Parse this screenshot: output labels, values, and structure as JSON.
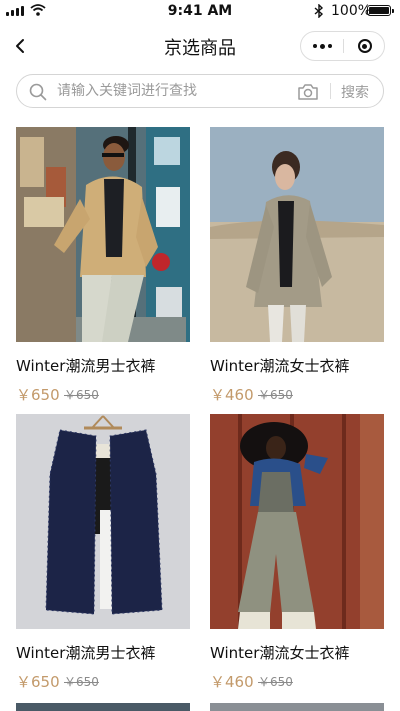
{
  "status_bar": {
    "time": "9:41 AM",
    "battery": "100%"
  },
  "nav": {
    "title": "京选商品",
    "icons": [
      "back-chevron-icon",
      "more-dots-icon",
      "close-circle-icon"
    ]
  },
  "search": {
    "placeholder": "请输入关键词进行查找",
    "value": "",
    "button_label": "搜索",
    "icons": [
      "search-icon",
      "camera-icon"
    ]
  },
  "products": [
    {
      "name": "Winter潮流男士衣裤",
      "price": "￥650",
      "original_price": "￥650"
    },
    {
      "name": "Winter潮流女士衣裤",
      "price": "￥460",
      "original_price": "￥650"
    },
    {
      "name": "Winter潮流男士衣裤",
      "price": "￥650",
      "original_price": "￥650"
    },
    {
      "name": "Winter潮流女士衣裤",
      "price": "￥460",
      "original_price": "￥650"
    }
  ]
}
